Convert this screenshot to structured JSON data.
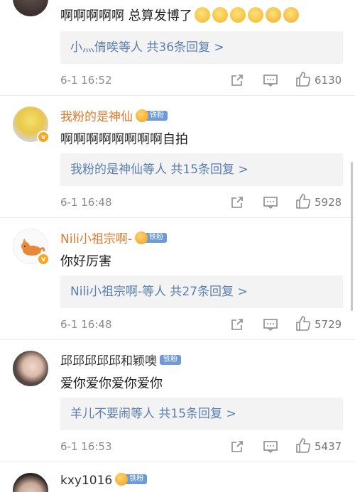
{
  "comments": [
    {
      "username": "",
      "text": "啊啊啊啊啊  总算发博了",
      "replies": "小灬倩唉等人 共36条回复 >",
      "time": "6-1 16:52",
      "likes": "6130"
    },
    {
      "username": "我粉的是神仙",
      "badge": "铁粉",
      "text": "啊啊啊啊啊啊啊啊自拍",
      "replies": "我粉的是神仙等人 共15条回复 >",
      "time": "6-1 16:48",
      "likes": "5928"
    },
    {
      "username": "Nili小祖宗啊-",
      "badge": "铁粉",
      "text": "你好厉害",
      "replies": "Nili小祖宗啊-等人 共27条回复 >",
      "time": "6-1 16:48",
      "likes": "5729"
    },
    {
      "username": "邱邱邱邱邱和颖噢",
      "badge": "铁粉",
      "text": "爱你爱你爱你爱你",
      "replies": "羊儿不要闹等人 共15条回复 >",
      "time": "6-1 16:53",
      "likes": "5437"
    },
    {
      "username": "kxy1016",
      "badge": "铁粉"
    }
  ],
  "colors": {
    "vip_name": "#e0782e",
    "reply_link": "#5b7fb0",
    "fan_badge": "#6e9ad8",
    "meta_text": "#8c8c8c"
  },
  "icons": [
    "share-icon",
    "comment-icon",
    "like-icon",
    "fan-badge-icon",
    "verified-badge-icon"
  ]
}
